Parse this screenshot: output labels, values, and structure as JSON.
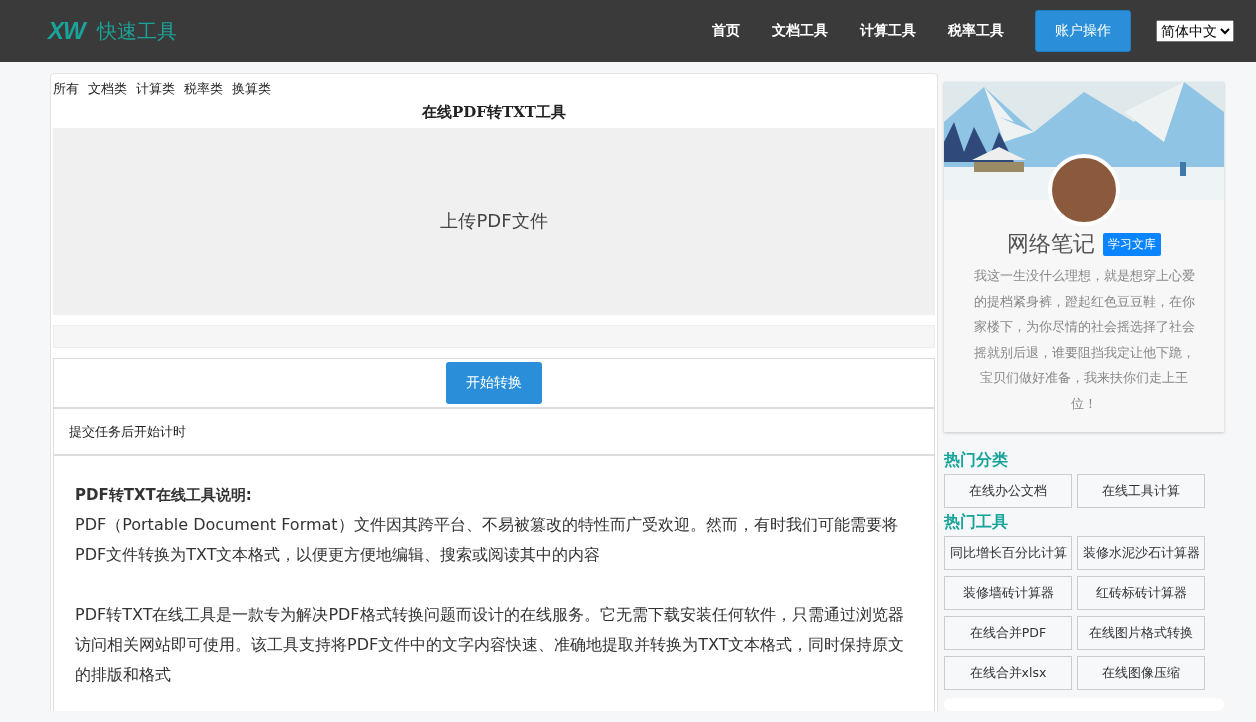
{
  "header": {
    "logo_mark": "XW",
    "logo_text": "快速工具",
    "nav": [
      {
        "label": "首页"
      },
      {
        "label": "文档工具"
      },
      {
        "label": "计算工具"
      },
      {
        "label": "税率工具"
      }
    ],
    "account_button": "账户操作",
    "language": "简体中文"
  },
  "main": {
    "categories": [
      {
        "label": "所有"
      },
      {
        "label": "文档类"
      },
      {
        "label": "计算类"
      },
      {
        "label": "税率类"
      },
      {
        "label": "换算类"
      }
    ],
    "title": "在线PDF转TXT工具",
    "upload_label": "上传PDF文件",
    "start_button": "开始转换",
    "timer_text": "提交任务后开始计时",
    "description": {
      "heading": "PDF转TXT在线工具说明:",
      "paragraphs": [
        "PDF（Portable Document Format）文件因其跨平台、不易被篡改的特性而广受欢迎。然而，有时我们可能需要将PDF文件转换为TXT文本格式，以便更方便地编辑、搜索或阅读其中的内容",
        "PDF转TXT在线工具是一款专为解决PDF格式转换问题而设计的在线服务。它无需下载安装任何软件，只需通过浏览器访问相关网站即可使用。该工具支持将PDF文件中的文字内容快速、准确地提取并转换为TXT文本格式，同时保持原文的排版和格式"
      ]
    }
  },
  "sidebar": {
    "profile": {
      "name": "网络笔记",
      "badge": "学习文库",
      "bio": "我这一生没什么理想，就是想穿上心爱的提档紧身裤，蹬起红色豆豆鞋，在你家楼下，为你尽情的社会摇选择了社会摇就别后退，谁要阻挡我定让他下跪，宝贝们做好准备，我来扶你们走上王位！"
    },
    "hot_categories": {
      "title": "热门分类",
      "items": [
        "在线办公文档",
        "在线工具计算"
      ]
    },
    "hot_tools": {
      "title": "热门工具",
      "items": [
        "同比增长百分比计算",
        "装修水泥沙石计算器",
        "装修墙砖计算器",
        "红砖标砖计算器",
        "在线合并PDF",
        "在线图片格式转换",
        "在线合并xlsx",
        "在线图像压缩"
      ]
    }
  }
}
